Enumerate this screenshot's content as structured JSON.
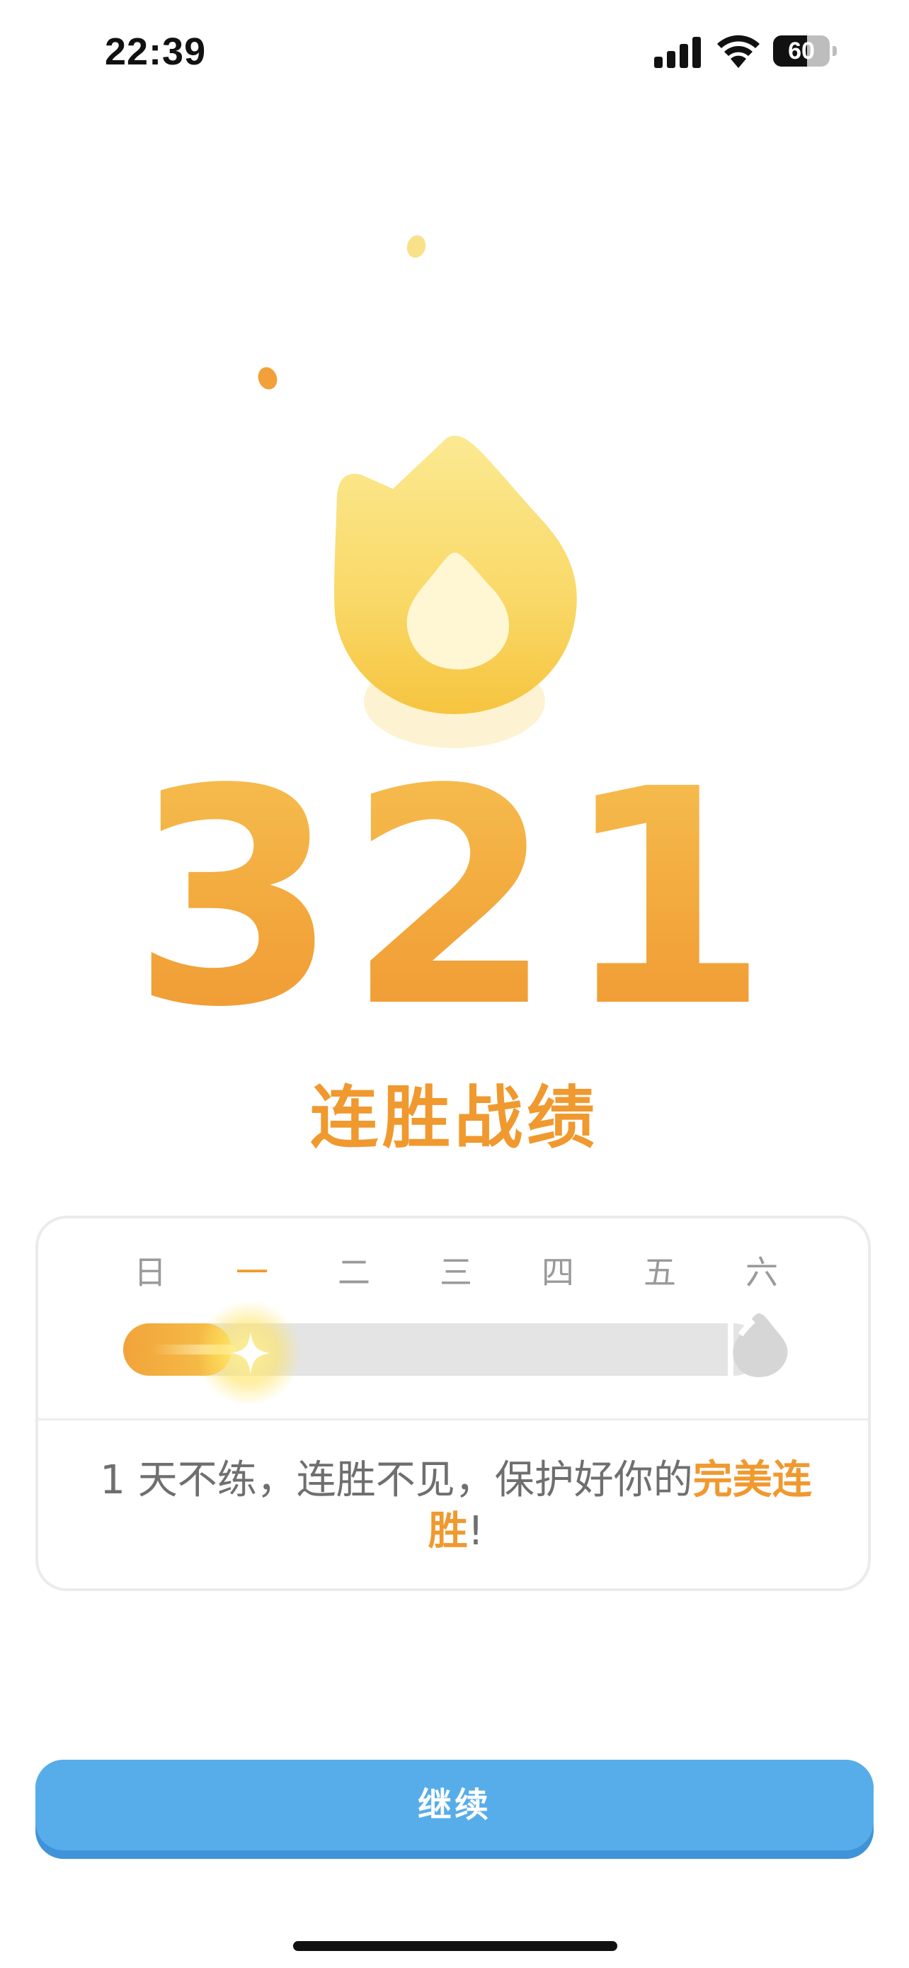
{
  "status_bar": {
    "time": "22:39",
    "battery": "60",
    "battery_level": 0.6
  },
  "streak": {
    "count": "321",
    "label": "连胜战绩"
  },
  "week": {
    "days": [
      "日",
      "一",
      "二",
      "三",
      "四",
      "五",
      "六"
    ],
    "active_day_index": 1,
    "progress": 0.17
  },
  "message": {
    "prefix": "1 天不练，连胜不见，保护好你的",
    "highlight": "完美连胜",
    "suffix": "!"
  },
  "continue_button": {
    "label": "继续"
  },
  "colors": {
    "accent_orange": "#f0992f",
    "flame_yellow": "#f8d95a",
    "button_blue": "#56ade9",
    "track_gray": "#e4e4e4"
  }
}
